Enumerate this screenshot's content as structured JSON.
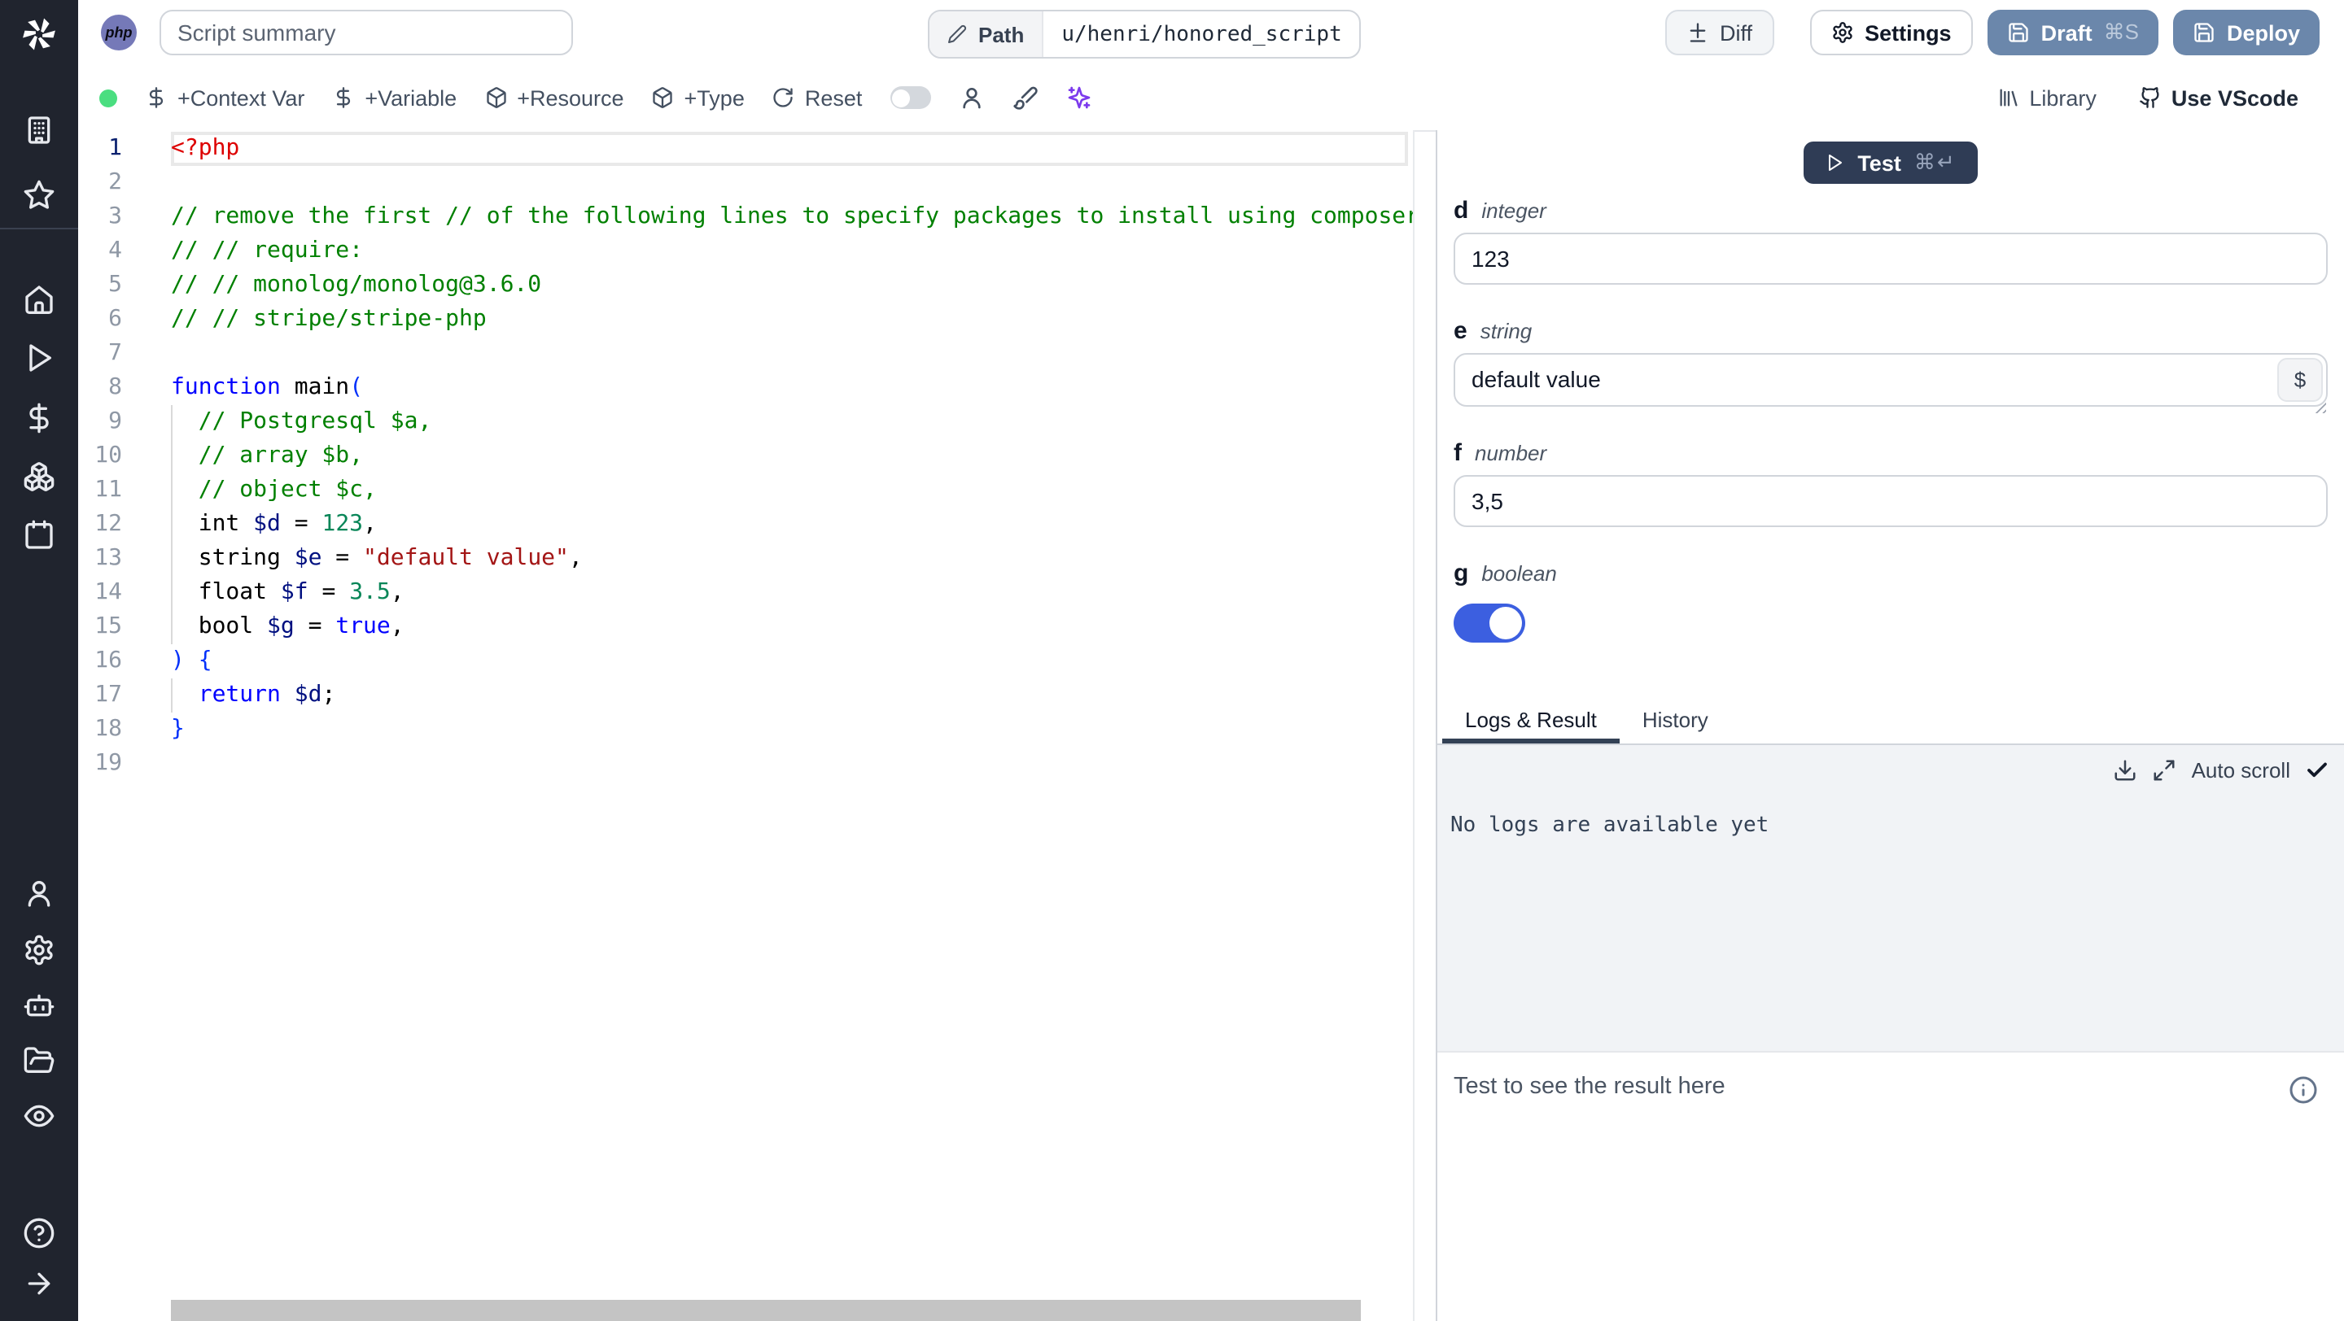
{
  "sidebar": {
    "icons_top": [
      "windmill-logo",
      "building",
      "star"
    ],
    "icons_middle": [
      "home",
      "play",
      "dollar",
      "boxes",
      "calendar"
    ],
    "icons_bottom": [
      "user",
      "settings",
      "bot",
      "folder-open",
      "eye"
    ],
    "icons_footer": [
      "help",
      "arrow-right"
    ]
  },
  "header": {
    "language_badge": "php",
    "summary_placeholder": "Script summary",
    "path_label": "Path",
    "path_value": "u/henri/honored_script",
    "diff_label": "Diff",
    "settings_label": "Settings",
    "draft_label": "Draft",
    "draft_shortcut": "⌘S",
    "deploy_label": "Deploy"
  },
  "toolbar": {
    "status_dot": "ready",
    "add_context_var": "+Context Var",
    "add_variable": "+Variable",
    "add_resource": "+Resource",
    "add_type": "+Type",
    "reset": "Reset",
    "preview_toggle_state": "off",
    "library": "Library",
    "use_vscode": "Use VScode"
  },
  "editor": {
    "language": "php",
    "lines": [
      {
        "n": 1,
        "active": true,
        "tokens": [
          {
            "t": "<?php",
            "c": "tag"
          }
        ]
      },
      {
        "n": 2,
        "tokens": []
      },
      {
        "n": 3,
        "tokens": [
          {
            "t": "// remove the first // of the following lines to specify packages to install using composer",
            "c": "comment"
          }
        ]
      },
      {
        "n": 4,
        "tokens": [
          {
            "t": "// // require:",
            "c": "comment"
          }
        ]
      },
      {
        "n": 5,
        "tokens": [
          {
            "t": "// // monolog/monolog@3.6.0",
            "c": "comment"
          }
        ]
      },
      {
        "n": 6,
        "tokens": [
          {
            "t": "// // stripe/stripe-php",
            "c": "comment"
          }
        ]
      },
      {
        "n": 7,
        "tokens": []
      },
      {
        "n": 8,
        "tokens": [
          {
            "t": "function",
            "c": "kw"
          },
          {
            "t": " main",
            "c": "plain"
          },
          {
            "t": "(",
            "c": "bracket"
          }
        ]
      },
      {
        "n": 9,
        "tokens": [
          {
            "t": "  ",
            "c": "plain"
          },
          {
            "t": "// Postgresql $a,",
            "c": "comment"
          }
        ]
      },
      {
        "n": 10,
        "tokens": [
          {
            "t": "  ",
            "c": "plain"
          },
          {
            "t": "// array $b,",
            "c": "comment"
          }
        ]
      },
      {
        "n": 11,
        "tokens": [
          {
            "t": "  ",
            "c": "plain"
          },
          {
            "t": "// object $c,",
            "c": "comment"
          }
        ]
      },
      {
        "n": 12,
        "tokens": [
          {
            "t": "  int ",
            "c": "plain"
          },
          {
            "t": "$d",
            "c": "var"
          },
          {
            "t": " = ",
            "c": "plain"
          },
          {
            "t": "123",
            "c": "num"
          },
          {
            "t": ",",
            "c": "plain"
          }
        ]
      },
      {
        "n": 13,
        "tokens": [
          {
            "t": "  string ",
            "c": "plain"
          },
          {
            "t": "$e",
            "c": "var"
          },
          {
            "t": " = ",
            "c": "plain"
          },
          {
            "t": "\"default value\"",
            "c": "str"
          },
          {
            "t": ",",
            "c": "plain"
          }
        ]
      },
      {
        "n": 14,
        "tokens": [
          {
            "t": "  float ",
            "c": "plain"
          },
          {
            "t": "$f",
            "c": "var"
          },
          {
            "t": " = ",
            "c": "plain"
          },
          {
            "t": "3.5",
            "c": "num"
          },
          {
            "t": ",",
            "c": "plain"
          }
        ]
      },
      {
        "n": 15,
        "tokens": [
          {
            "t": "  bool ",
            "c": "plain"
          },
          {
            "t": "$g",
            "c": "var"
          },
          {
            "t": " = ",
            "c": "plain"
          },
          {
            "t": "true",
            "c": "kw"
          },
          {
            "t": ",",
            "c": "plain"
          }
        ]
      },
      {
        "n": 16,
        "tokens": [
          {
            "t": ") {",
            "c": "bracket"
          }
        ]
      },
      {
        "n": 17,
        "tokens": [
          {
            "t": "  ",
            "c": "plain"
          },
          {
            "t": "return",
            "c": "kw"
          },
          {
            "t": " ",
            "c": "plain"
          },
          {
            "t": "$d",
            "c": "var"
          },
          {
            "t": ";",
            "c": "plain"
          }
        ]
      },
      {
        "n": 18,
        "tokens": [
          {
            "t": "}",
            "c": "bracket"
          }
        ]
      },
      {
        "n": 19,
        "tokens": []
      }
    ]
  },
  "form": {
    "test_button": {
      "label": "Test",
      "shortcut": "⌘↵"
    },
    "fields": [
      {
        "name": "d",
        "type": "integer",
        "value": "123",
        "control": "input"
      },
      {
        "name": "e",
        "type": "string",
        "value": "default value",
        "control": "textarea",
        "insert_var_label": "$"
      },
      {
        "name": "f",
        "type": "number",
        "value": "3,5",
        "control": "input"
      },
      {
        "name": "g",
        "type": "boolean",
        "value": true,
        "control": "toggle"
      }
    ]
  },
  "results": {
    "tabs": [
      {
        "label": "Logs & Result",
        "active": true
      },
      {
        "label": "History",
        "active": false
      }
    ],
    "autoscroll_label": "Auto scroll",
    "logs_empty_text": "No logs are available yet",
    "result_placeholder": "Test to see the result here"
  },
  "colors": {
    "draft_deploy_button": "#6b87ab",
    "test_button": "#2f3c55",
    "toggle_on": "#3c5fe0",
    "status_dot": "#4ade80",
    "sparkles_icon": "#7c3aed",
    "php_badge": "#7579b8",
    "active_tab_underline": "#334155"
  }
}
